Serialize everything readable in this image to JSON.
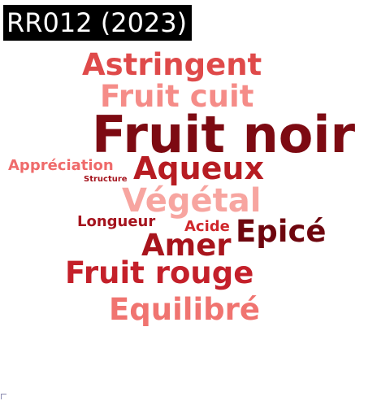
{
  "title": "RR012 (2023)",
  "words": [
    {
      "id": "astringent",
      "text": "Astringent",
      "color": "#df4a4a"
    },
    {
      "id": "fruit-cuit",
      "text": "Fruit cuit",
      "color": "#f58c88"
    },
    {
      "id": "fruit-noir",
      "text": "Fruit noir",
      "color": "#7d0a12"
    },
    {
      "id": "appreciation",
      "text": "Appréciation",
      "color": "#ef6b6b"
    },
    {
      "id": "structure",
      "text": "Structure",
      "color": "#a5141e"
    },
    {
      "id": "aqueux",
      "text": "Aqueux",
      "color": "#b71c22"
    },
    {
      "id": "vegetal",
      "text": "Végétal",
      "color": "#f7a5a0"
    },
    {
      "id": "longueur",
      "text": "Longueur",
      "color": "#a5141e"
    },
    {
      "id": "acide",
      "text": "Acide",
      "color": "#d0282c"
    },
    {
      "id": "epice",
      "text": "Epicé",
      "color": "#6e060e"
    },
    {
      "id": "amer",
      "text": "Amer",
      "color": "#a8141c"
    },
    {
      "id": "fruit-rouge",
      "text": "Fruit rouge",
      "color": "#c4202a"
    },
    {
      "id": "equilibre",
      "text": "Equilibré",
      "color": "#f07470"
    }
  ]
}
